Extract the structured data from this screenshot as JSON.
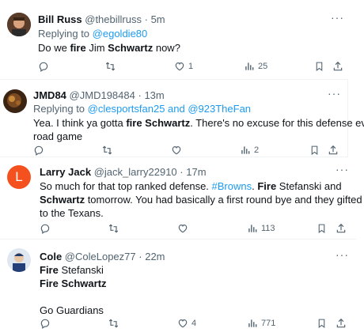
{
  "tweets": [
    {
      "name": "Bill Russ",
      "handle": "@thebillruss",
      "sep": "·",
      "time": "5m",
      "replying": "Replying to",
      "mention": "@egoldie80",
      "text_a": "Do we ",
      "text_b": "fire",
      "text_c": " Jim ",
      "text_d": "Schwartz",
      "text_e": " now?",
      "likes": "1",
      "views": "25"
    },
    {
      "name": "JMD84",
      "handle": "@JMD198484",
      "sep": "·",
      "time": "13m",
      "replying": "Replying to",
      "mention1": "@clesportsfan25",
      "and": " and ",
      "mention2": "@923TheFan",
      "text_a": "Yea. I think ya gotta ",
      "text_b": "fire Schwartz",
      "text_c": ". There's no excuse for this defense every",
      "text_d": "road game",
      "views": "2"
    },
    {
      "name": "Larry Jack",
      "handle": "@jack_larry22910",
      "sep": "·",
      "time": "17m",
      "avatar_letter": "L",
      "text_a": "So much for that top ranked defense. ",
      "hashtag": "#Browns",
      "text_b": ". ",
      "text_c": "Fire",
      "text_d": " Stefanski and",
      "text_e": "Schwartz",
      "text_f": " tomorrow. You had basically a first round bye and they gifted it",
      "text_g": "to the Texans.",
      "views": "113"
    },
    {
      "name": "Cole",
      "handle": "@ColeLopez77",
      "sep": "·",
      "time": "22m",
      "line1_a": "Fire",
      "line1_b": " Stefanski",
      "line2": "Fire Schwartz",
      "line3": "Go Guardians",
      "likes": "4",
      "views": "771"
    }
  ],
  "more_label": "···",
  "colors": {
    "link": "#1d9bf0",
    "muted": "#536471",
    "text": "#0f1419",
    "larry_avatar": "#f4511e"
  },
  "icons": [
    "reply-icon",
    "retweet-icon",
    "like-icon",
    "views-icon",
    "bookmark-icon",
    "share-icon",
    "more-icon"
  ]
}
